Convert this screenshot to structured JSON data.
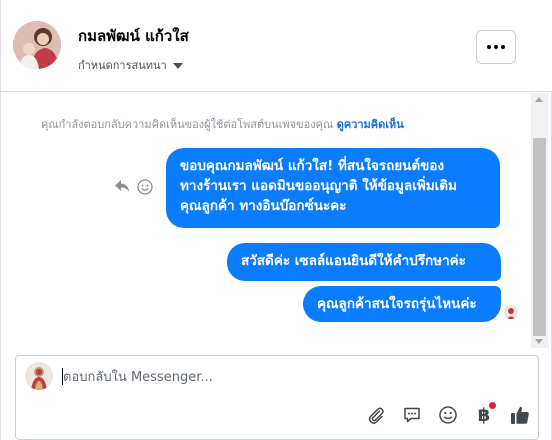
{
  "header": {
    "contact_name": "กมลพัฒน์ แก้วใส",
    "assign_label": "กำหนดการสนทนา",
    "more_icon": "more-horizontal-icon"
  },
  "conversation": {
    "notice_text": "คุณกำลังตอบกลับความคิดเห็นของผู้ใช้ต่อโพสต์บนเพจของคุณ",
    "notice_link": "ดูความคิดเห็น",
    "messages": [
      {
        "lines": [
          "ขอบคุณกมลพัฒน์ แก้วใส! ที่สนใจรถยนต์ของ",
          "ทางร้านเรา แอดมินขออนุญาติ ให้ข้อมูลเพิ่มเติม",
          "คุณลูกค้า ทางอินบ๊อกซ์นะคะ"
        ]
      },
      {
        "text": "สวัสดีค่ะ เซลล์แอนยินดีให้คำปรึกษาค่ะ"
      },
      {
        "text": "คุณลูกค้าสนใจรถรุ่นไหนค่ะ"
      }
    ]
  },
  "composer": {
    "placeholder": "ตอบกลับใน Messenger...",
    "value": "",
    "tools": [
      "attach-icon",
      "saved-reply-icon",
      "emoji-icon",
      "baht-payment-icon",
      "like-icon"
    ],
    "baht_symbol": "฿"
  },
  "colors": {
    "bubble": "#0a7cff",
    "link": "#1a6fd4",
    "notice": "#8d949e",
    "badge": "#e41e3f"
  }
}
